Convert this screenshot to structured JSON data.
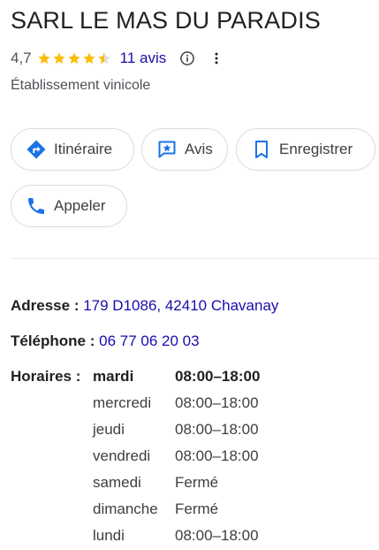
{
  "place": {
    "name": "SARL LE MAS DU PARADIS",
    "rating": "4,7",
    "stars_filled": 4.5,
    "reviews_label": "11 avis",
    "category": "Établissement vinicole"
  },
  "actions": {
    "directions": "Itinéraire",
    "reviews": "Avis",
    "save": "Enregistrer",
    "call": "Appeler"
  },
  "details": {
    "address_label": "Adresse :",
    "address": "179 D1086, 42410 Chavanay",
    "phone_label": "Téléphone :",
    "phone": "06 77 06 20 03",
    "hours_label": "Horaires :"
  },
  "hours": [
    {
      "day": "mardi",
      "time": "08:00–18:00"
    },
    {
      "day": "mercredi",
      "time": "08:00–18:00"
    },
    {
      "day": "jeudi",
      "time": "08:00–18:00"
    },
    {
      "day": "vendredi",
      "time": "08:00–18:00"
    },
    {
      "day": "samedi",
      "time": "Fermé"
    },
    {
      "day": "dimanche",
      "time": "Fermé"
    },
    {
      "day": "lundi",
      "time": "08:00–18:00"
    }
  ],
  "colors": {
    "accent": "#1a73e8",
    "link": "#1a0dab",
    "star": "#fbbc04",
    "star_empty": "#dadce0"
  },
  "icons": {
    "directions": "directions-diamond-icon",
    "reviews": "review-star-icon",
    "save": "bookmark-icon",
    "call": "phone-icon",
    "info": "info-icon",
    "more": "more-vertical-icon"
  }
}
